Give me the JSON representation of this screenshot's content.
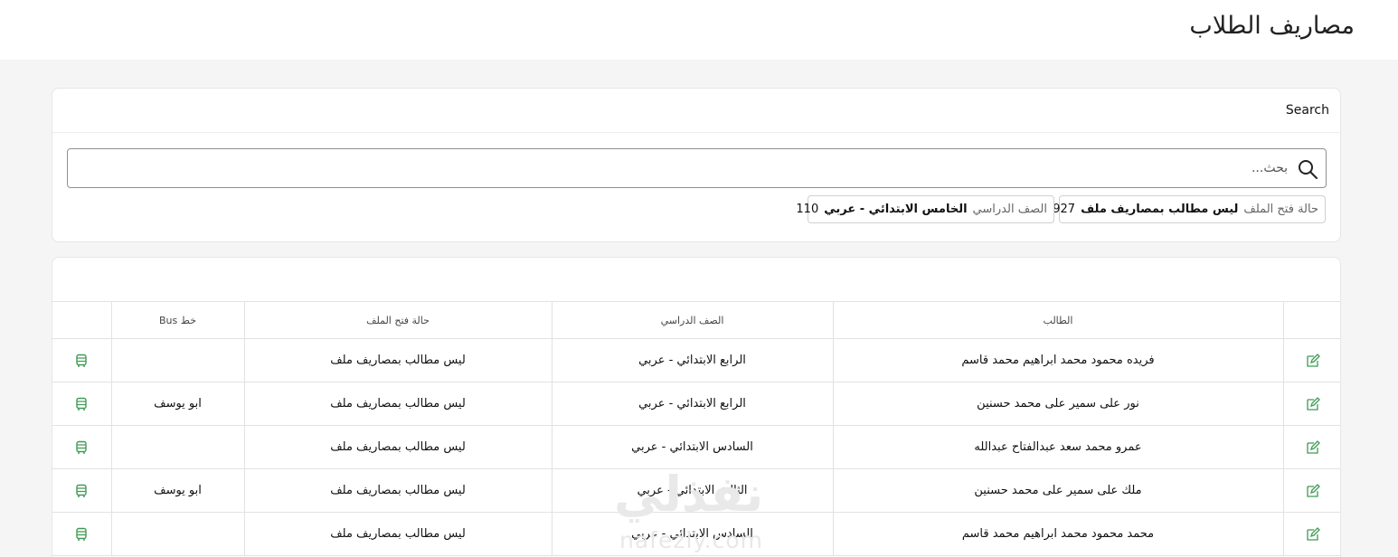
{
  "page": {
    "title": "مصاريف الطلاب"
  },
  "search": {
    "heading": "Search",
    "placeholder": "بحث...",
    "filters": [
      {
        "label": "حالة فتح الملف",
        "value": "ليس مطالب بمصاريف ملف",
        "count": "927"
      },
      {
        "label": "الصف الدراسي",
        "value": "الخامس الابتدائي - عربي",
        "count": "110"
      }
    ]
  },
  "table": {
    "columns": [
      {
        "label": ""
      },
      {
        "label": "الطالب"
      },
      {
        "label": "الصف الدراسي"
      },
      {
        "label": "حالة فتح الملف"
      },
      {
        "label": "خط Bus"
      },
      {
        "label": ""
      }
    ],
    "rows": [
      {
        "student": "فريده محمود محمد ابراهيم محمد قاسم",
        "grade": "الرابع الابتدائي - عربي",
        "file_status": "ليس مطالب بمصاريف ملف",
        "bus_line": ""
      },
      {
        "student": "نور على سمير على محمد حسنين",
        "grade": "الرابع الابتدائي - عربي",
        "file_status": "ليس مطالب بمصاريف ملف",
        "bus_line": "ابو يوسف"
      },
      {
        "student": "عمرو محمد سعد عبدالفتاح عبدالله",
        "grade": "السادس الابتدائي - عربي",
        "file_status": "ليس مطالب بمصاريف ملف",
        "bus_line": ""
      },
      {
        "student": "ملك على سمير على محمد حسنين",
        "grade": "الثالث الابتدائي - عربي",
        "file_status": "ليس مطالب بمصاريف ملف",
        "bus_line": "ابو يوسف"
      },
      {
        "student": "محمد محمود محمد ابراهيم محمد قاسم",
        "grade": "السادس الابتدائي - عربي",
        "file_status": "ليس مطالب بمصاريف ملف",
        "bus_line": ""
      }
    ],
    "icons": {
      "edit": "edit-icon",
      "bus": "bus-icon"
    }
  },
  "watermark": {
    "word": "نفذلي",
    "domain": "nafezly.com"
  },
  "colors": {
    "accent_green": "#3f9a55",
    "background": "#f5f5f5"
  }
}
